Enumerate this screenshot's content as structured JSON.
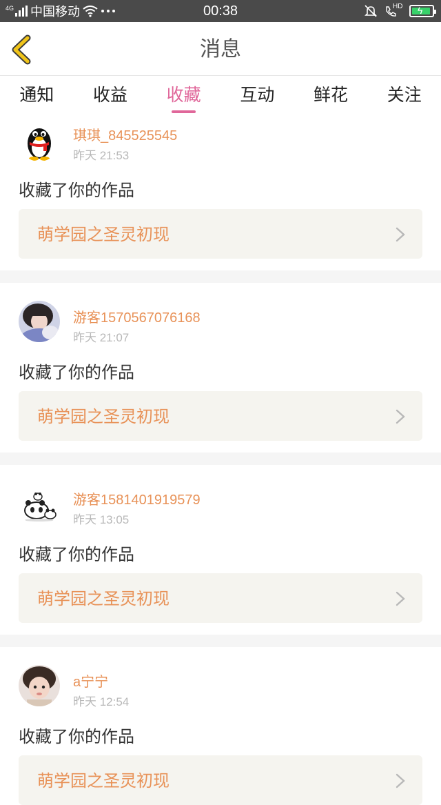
{
  "status_bar": {
    "network_label": "4G",
    "carrier": "中国移动",
    "time": "00:38",
    "hd_label": "HD",
    "icons": [
      "signal-icon",
      "wifi-icon",
      "more-dots-icon",
      "mute-bell-icon",
      "hd-call-icon",
      "battery-charging-icon"
    ]
  },
  "header": {
    "title": "消息",
    "back_icon": "chevron-left-icon",
    "back_color": "#f0c419"
  },
  "tabs": [
    {
      "label": "通知",
      "active": false
    },
    {
      "label": "收益",
      "active": false
    },
    {
      "label": "收藏",
      "active": true
    },
    {
      "label": "互动",
      "active": false
    },
    {
      "label": "鲜花",
      "active": false
    },
    {
      "label": "关注",
      "active": false
    }
  ],
  "accent_color": "#e0679a",
  "name_color": "#e89258",
  "messages": [
    {
      "username": "琪琪_845525545",
      "time": "昨天 21:53",
      "action": "收藏了你的作品",
      "work_title": "萌学园之圣灵初现",
      "avatar": "penguin-avatar"
    },
    {
      "username": "游客1570567076168",
      "time": "昨天 21:07",
      "action": "收藏了你的作品",
      "work_title": "萌学园之圣灵初现",
      "avatar": "girl-photo-avatar"
    },
    {
      "username": "游客1581401919579",
      "time": "昨天 13:05",
      "action": "收藏了你的作品",
      "work_title": "萌学园之圣灵初现",
      "avatar": "panda-avatar"
    },
    {
      "username": "a宁宁",
      "time": "昨天 12:54",
      "action": "收藏了你的作品",
      "work_title": "萌学园之圣灵初现",
      "avatar": "child-photo-avatar"
    }
  ]
}
